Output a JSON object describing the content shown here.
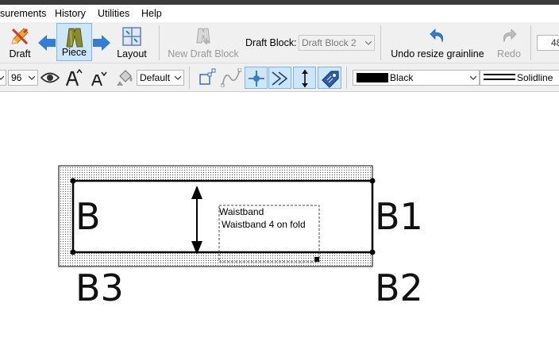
{
  "menu": {
    "items": [
      "surements",
      "History",
      "Utilities",
      "Help"
    ]
  },
  "toolbar": {
    "draft_label": "Draft",
    "piece_label": "Piece",
    "layout_label": "Layout",
    "new_draft_block_label": "New Draft Block",
    "draft_block_label": "Draft Block:",
    "draft_block_value": "Draft Block 2",
    "undo_label": "Undo resize grainline",
    "redo_label": "Redo",
    "zoom_partial": "48"
  },
  "toolbar2": {
    "font_size": "96",
    "font_default": "Default",
    "line_color": "Black",
    "line_style": "Solidline"
  },
  "canvas": {
    "points": {
      "b": "B",
      "b1": "B1",
      "b2": "B2",
      "b3": "B3"
    },
    "piece_name": "Waistband",
    "piece_info": "Waistband 4 on fold"
  },
  "colors": {
    "accent_blue": "#2e7fd9",
    "active_bg": "#cde6fb",
    "line_black": "#000000"
  }
}
